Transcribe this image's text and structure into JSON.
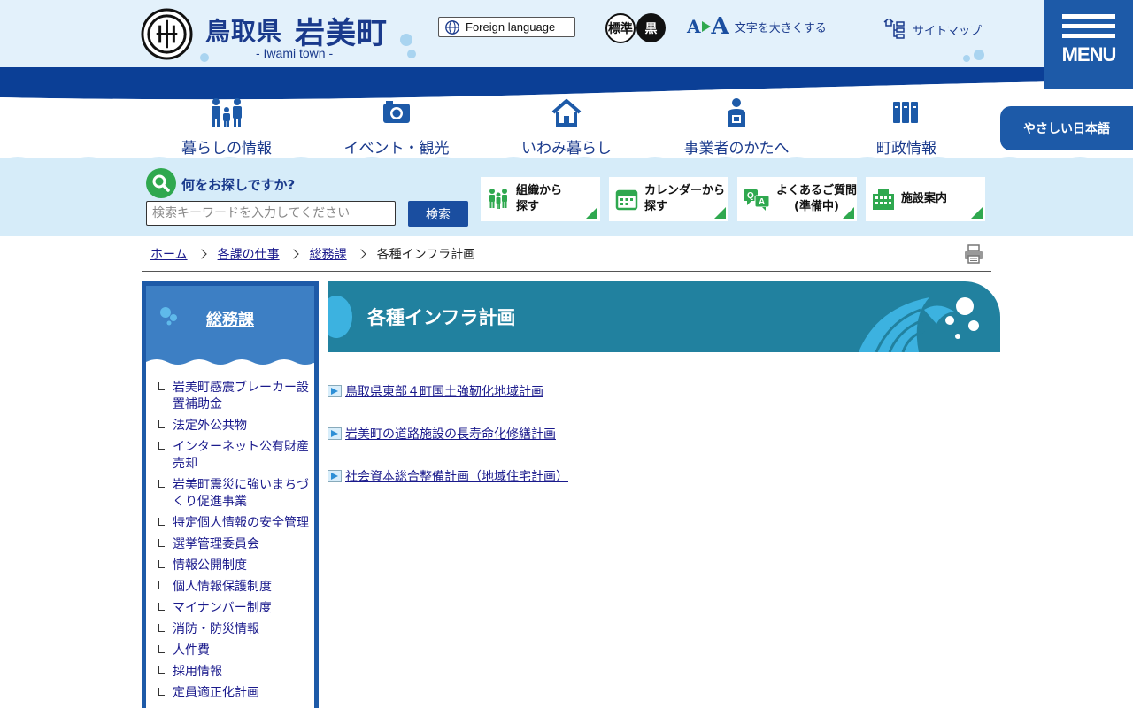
{
  "header": {
    "logo_pref": "鳥取県",
    "logo_town": "岩美町",
    "logo_sub": "- Iwami town -",
    "lang_label": "Foreign language",
    "mode_standard": "標準",
    "mode_black": "黒",
    "fontsize_a_small": "A",
    "fontsize_a_large": "A",
    "fontsize_label": "文字を大きくする",
    "sitemap_label": "サイトマップ",
    "menu_label": "MENU",
    "easy_japanese": "やさしい日本語"
  },
  "gnav": [
    {
      "label": "暮らしの情報",
      "icon": "family-icon"
    },
    {
      "label": "イベント・観光",
      "icon": "camera-icon"
    },
    {
      "label": "いわみ暮らし",
      "icon": "house-icon"
    },
    {
      "label": "事業者のかたへ",
      "icon": "businessperson-icon"
    },
    {
      "label": "町政情報",
      "icon": "books-icon"
    }
  ],
  "search": {
    "heading": "何をお探しですか?",
    "placeholder": "検索キーワードを入力してください",
    "button": "検索"
  },
  "quick_links": [
    {
      "line1": "組織から",
      "line2": "探す",
      "icon": "organization-icon"
    },
    {
      "line1": "カレンダーから",
      "line2": "探す",
      "icon": "calendar-icon"
    },
    {
      "line1": "よくあるご質問",
      "line2": "(準備中)",
      "icon": "qa-icon"
    },
    {
      "line1": "施設案内",
      "line2": "",
      "icon": "building-icon"
    }
  ],
  "breadcrumb": {
    "home": "ホーム",
    "level1": "各課の仕事",
    "level2": "総務課",
    "current": "各種インフラ計画"
  },
  "side": {
    "title": "総務課",
    "items": [
      "岩美町感震ブレーカー設置補助金",
      "法定外公共物",
      "インターネット公有財産売却",
      "岩美町震災に強いまちづくり促進事業",
      "特定個人情報の安全管理",
      "選挙管理委員会",
      "情報公開制度",
      "個人情報保護制度",
      "マイナンバー制度",
      "消防・防災情報",
      "人件費",
      "採用情報",
      "定員適正化計画"
    ]
  },
  "main": {
    "title": "各種インフラ計画",
    "links": [
      "鳥取県東部４町国土強靭化地域計画",
      "岩美町の道路施設の長寿命化修繕計画",
      "社会資本総合整備計画（地域住宅計画）"
    ]
  },
  "colors": {
    "brand_navy": "#1a3a8c",
    "menu_blue": "#1d5aa8",
    "title_teal": "#21819f",
    "accent_green": "#2fa84f",
    "sky_light": "#e3f1fb"
  }
}
